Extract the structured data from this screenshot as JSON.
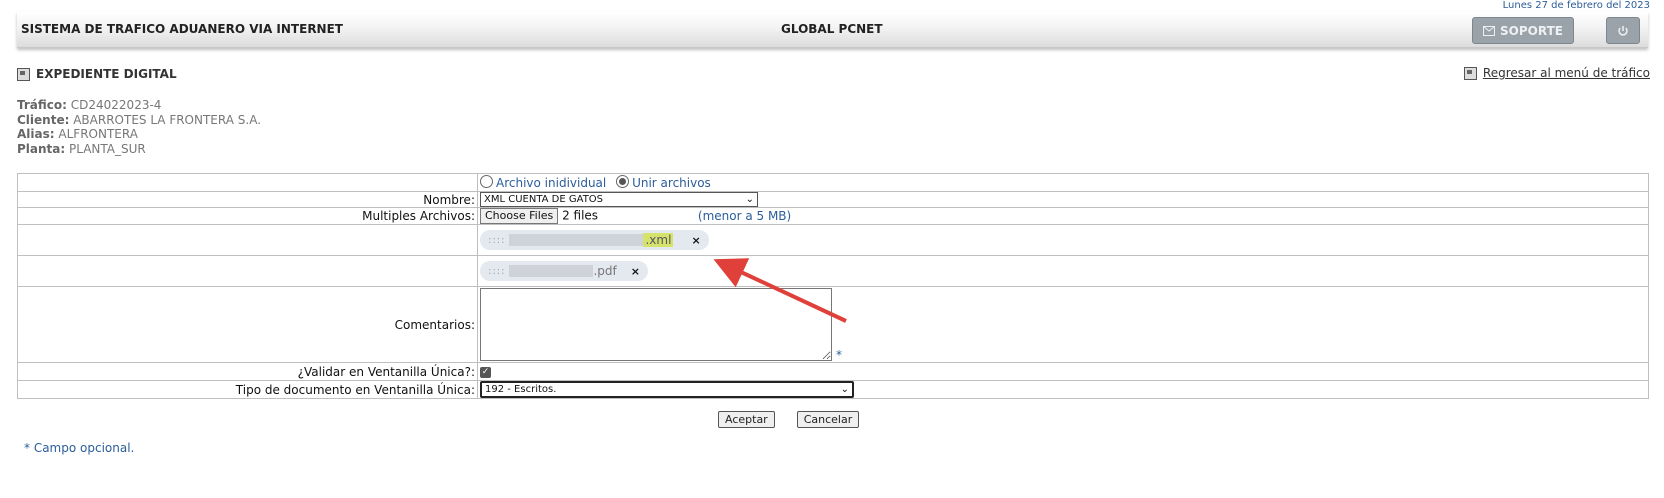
{
  "header": {
    "date": "Lunes 27 de febrero del 2023",
    "system_title": "SISTEMA DE TRAFICO ADUANERO VIA INTERNET",
    "app_title": "GLOBAL PCNET",
    "support_label": "SOPORTE",
    "support_icon": "envelope-icon",
    "power_icon": "power-icon"
  },
  "section": {
    "title": "EXPEDIENTE DIGITAL",
    "back_link": "Regresar al menú de tráfico"
  },
  "info": {
    "trafico_label": "Tráfico:",
    "trafico_value": "CD24022023-4",
    "cliente_label": "Cliente:",
    "cliente_value": "ABARROTES LA FRONTERA S.A.",
    "alias_label": "Alias:",
    "alias_value": "ALFRONTERA",
    "planta_label": "Planta:",
    "planta_value": "PLANTA_SUR"
  },
  "form": {
    "mode_option_1": "Archivo inidividual",
    "mode_option_2": "Unir archivos",
    "selected_mode": "Unir archivos",
    "nombre_label": "Nombre:",
    "nombre_value": "XML CUENTA DE GATOS",
    "multiples_label": "Multiples Archivos:",
    "choose_files": "Choose Files",
    "files_count": "2 files",
    "size_limit": "(menor a 5 MB)",
    "files": [
      {
        "grip": "::::",
        "ext": ".xml",
        "remove": "×"
      },
      {
        "grip": "::::",
        "ext": ".pdf",
        "remove": "×"
      }
    ],
    "comentarios_label": "Comentarios:",
    "optional_mark": "*",
    "validar_label": "¿Validar en Ventanilla Única?:",
    "validar_checked": true,
    "tipo_label": "Tipo de documento en Ventanilla Única:",
    "tipo_value": "192 - Escritos."
  },
  "actions": {
    "accept": "Aceptar",
    "cancel": "Cancelar"
  },
  "footnote": "* Campo opcional.",
  "colors": {
    "link_blue": "#2c5d9a",
    "highlight": "#d5e36a",
    "annotation_arrow": "#e0403a"
  }
}
